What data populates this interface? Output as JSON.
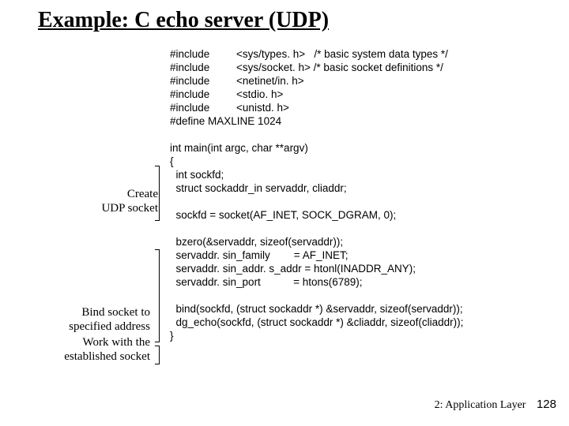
{
  "title": "Example: C echo server (UDP)",
  "code_block": "#include         <sys/types. h>   /* basic system data types */\n#include         <sys/socket. h> /* basic socket definitions */\n#include         <netinet/in. h>\n#include         <stdio. h>\n#include         <unistd. h>\n#define MAXLINE 1024\n\nint main(int argc, char **argv)\n{\n  int sockfd;\n  struct sockaddr_in servaddr, cliaddr;\n\n  sockfd = socket(AF_INET, SOCK_DGRAM, 0);\n\n  bzero(&servaddr, sizeof(servaddr));\n  servaddr. sin_family        = AF_INET;\n  servaddr. sin_addr. s_addr = htonl(INADDR_ANY);\n  servaddr. sin_port           = htons(6789);\n\n  bind(sockfd, (struct sockaddr *) &servaddr, sizeof(servaddr));\n  dg_echo(sockfd, (struct sockaddr *) &cliaddr, sizeof(cliaddr));\n}",
  "annotations": {
    "a1": "Create\nUDP socket",
    "a2": "Bind socket to\nspecified address",
    "a3": "Work with the\nestablished socket"
  },
  "footer": {
    "chapter": "2: Application Layer",
    "page_number": "128"
  }
}
